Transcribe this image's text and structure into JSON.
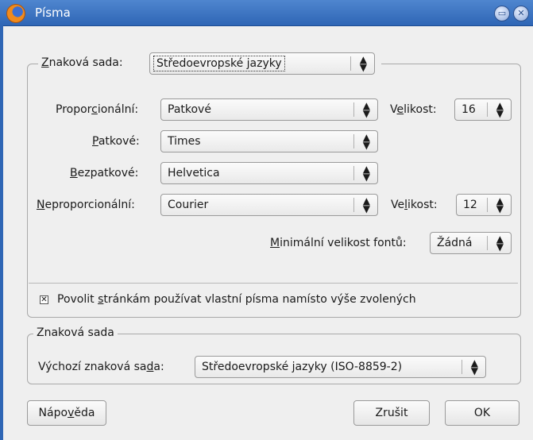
{
  "window": {
    "title": "Písma"
  },
  "charset_row": {
    "prefix": "Z",
    "label": "naková sada:",
    "value": "Středoevropské jazyky"
  },
  "fonts": {
    "proportional": {
      "pre": "Propor",
      "ul": "c",
      "post": "ionální:",
      "value": "Patkové"
    },
    "serif": {
      "pre": "",
      "ul": "P",
      "post": "atkové:",
      "value": "Times"
    },
    "sans": {
      "pre": "",
      "ul": "B",
      "post": "ezpatkové:",
      "value": "Helvetica"
    },
    "mono": {
      "pre": "",
      "ul": "N",
      "post": "eproporcionální:",
      "value": "Courier"
    },
    "size1": {
      "pre": "V",
      "ul": "e",
      "post": "likost:",
      "value": "16"
    },
    "size2": {
      "pre": "Ve",
      "ul": "l",
      "post": "ikost:",
      "value": "12"
    },
    "minsize": {
      "pre": "",
      "ul": "M",
      "post": "inimální velikost fontů:",
      "value": "Žádná"
    }
  },
  "allow_pages": {
    "checked": true,
    "pre": "Povolit ",
    "ul": "s",
    "post": "tránkám používat vlastní písma namísto výše zvolených"
  },
  "charset_group": {
    "legend": "Znaková sada",
    "pre": "Výchozí znaková sa",
    "ul": "d",
    "post": "a:",
    "value": "Středoevropské jazyky (ISO-8859-2)"
  },
  "buttons": {
    "help": {
      "pre": "Nápo",
      "ul": "v",
      "post": "ěda"
    },
    "cancel": "Zrušit",
    "ok": "OK"
  },
  "icons": {
    "combo_arrow": "⬍",
    "check_mark": "✕",
    "minimize": "▭",
    "close": "✕"
  }
}
